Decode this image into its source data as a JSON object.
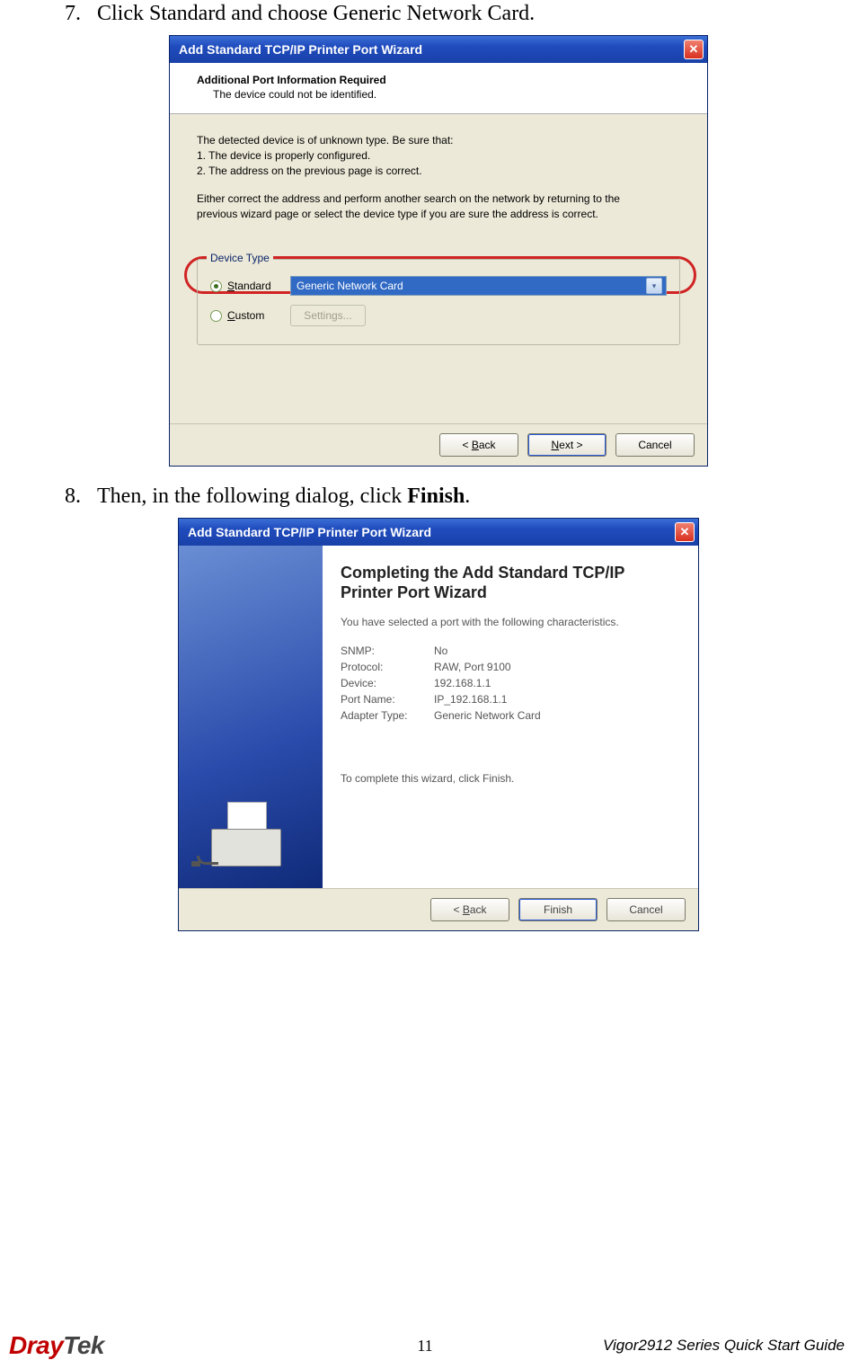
{
  "step7": {
    "num": "7.",
    "text_pre": "Click Standard and choose Generic Network Card."
  },
  "step8": {
    "num": "8.",
    "text_pre": "Then, in the following dialog, click ",
    "text_bold": "Finish",
    "text_post": "."
  },
  "dlg1": {
    "title": "Add Standard TCP/IP Printer Port Wizard",
    "header_title": "Additional Port Information Required",
    "header_sub": "The device could not be identified.",
    "body_intro": "The detected device is of unknown type.  Be sure that:",
    "body_l1": "1.  The device is properly configured.",
    "body_l2": "2.   The address on the previous page is correct.",
    "body_p2a": "Either correct the address and perform another search on the network by returning to the",
    "body_p2b": "previous wizard page or select the device type if you are sure the address is correct.",
    "fieldset_legend": "Device Type",
    "radio_standard_u": "S",
    "radio_standard_rest": "tandard",
    "radio_custom_u": "C",
    "radio_custom_rest": "ustom",
    "select_value": "Generic Network Card",
    "settings_btn_pre": "S",
    "settings_btn_u": "e",
    "settings_btn_rest": "ttings...",
    "btn_back_pre": "< ",
    "btn_back_u": "B",
    "btn_back_rest": "ack",
    "btn_next_u": "N",
    "btn_next_rest": "ext >",
    "btn_cancel": "Cancel"
  },
  "dlg2": {
    "title": "Add Standard TCP/IP Printer Port Wizard",
    "heading": "Completing the Add Standard TCP/IP Printer Port Wizard",
    "lead": "You have selected a port with the following characteristics.",
    "rows": {
      "snmp_k": "SNMP:",
      "snmp_v": "No",
      "proto_k": "Protocol:",
      "proto_v": "RAW, Port 9100",
      "dev_k": "Device:",
      "dev_v": "192.168.1.1",
      "port_k": "Port Name:",
      "port_v": "IP_192.168.1.1",
      "adpt_k": "Adapter Type:",
      "adpt_v": "Generic Network Card"
    },
    "complete": "To complete this wizard, click Finish.",
    "btn_back_pre": "< ",
    "btn_back_u": "B",
    "btn_back_rest": "ack",
    "btn_finish": "Finish",
    "btn_cancel": "Cancel"
  },
  "footer": {
    "brand_dray": "Dray",
    "brand_tek": "Tek",
    "page_num": "11",
    "guide": "Vigor2912 Series Quick Start Guide"
  }
}
